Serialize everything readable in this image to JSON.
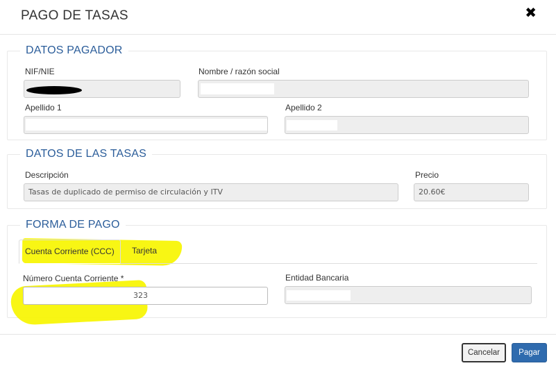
{
  "modal": {
    "title": "PAGO DE TASAS",
    "close_label": "✖"
  },
  "datos_pagador": {
    "legend": "DATOS PAGADOR",
    "nif_label": "NIF/NIE",
    "nombre_label": "Nombre / razón social",
    "apellido1_label": "Apellido 1",
    "apellido2_label": "Apellido 2"
  },
  "datos_tasas": {
    "legend": "DATOS DE LAS TASAS",
    "descripcion_label": "Descripción",
    "descripcion_value": "Tasas de duplicado de permiso de circulación y ITV",
    "precio_label": "Precio",
    "precio_value": "20.60€"
  },
  "forma_pago": {
    "legend": "FORMA DE PAGO",
    "tabs": [
      {
        "label": "Cuenta Corriente (CCC)",
        "active": true
      },
      {
        "label": "Tarjeta",
        "active": false
      }
    ],
    "cuenta_label": "Número Cuenta Corriente *",
    "cuenta_value_visible": "323",
    "entidad_label": "Entidad Bancaria"
  },
  "footer": {
    "cancel_label": "Cancelar",
    "pay_label": "Pagar"
  },
  "colors": {
    "legend_blue": "#2b5d9a",
    "pay_button": "#2f6bae",
    "highlight_yellow": "#f7f500"
  }
}
